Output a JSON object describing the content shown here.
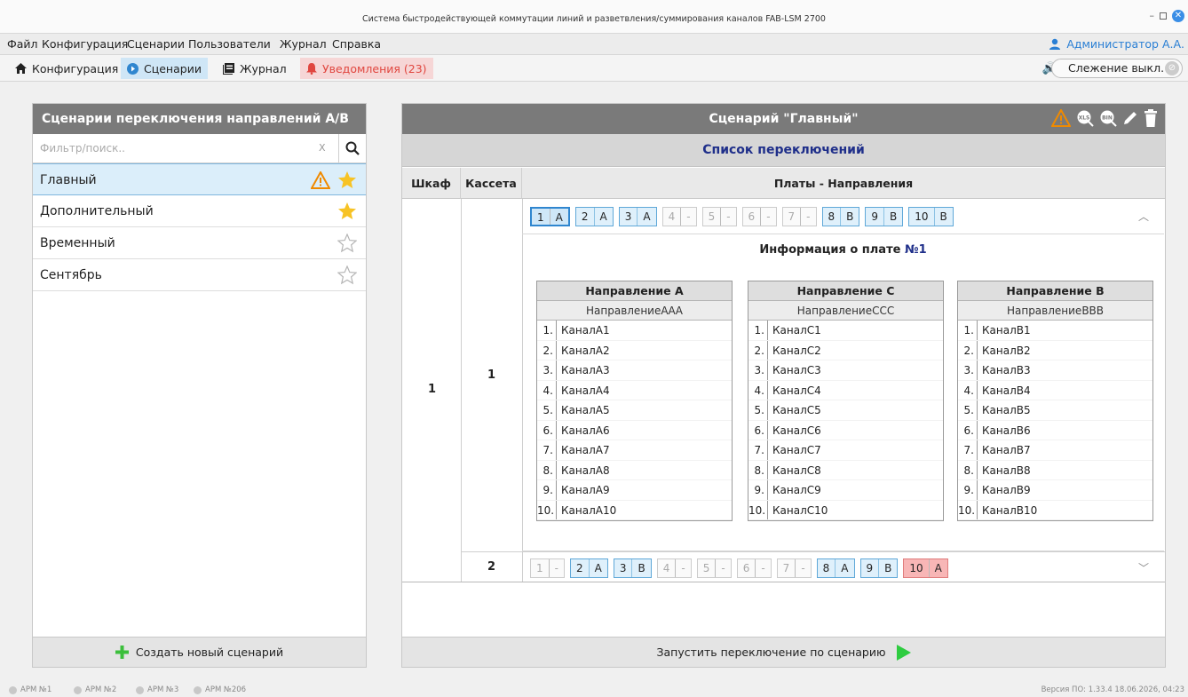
{
  "window": {
    "title": "Система быстродействующей коммутации линий и разветвления/суммирования каналов FAB-LSM 2700"
  },
  "menu": [
    "Файл",
    "Конфигурация",
    "Сценарии",
    "Пользователи",
    "Журнал",
    "Справка"
  ],
  "user": "Администратор А.А.",
  "toolbar": {
    "config": "Конфигурация",
    "scenarios": "Сценарии",
    "journal": "Журнал",
    "notifications": "Уведомления (23)",
    "tracking": "Слежение выкл."
  },
  "left": {
    "title": "Сценарии переключения направлений А/В",
    "filter_placeholder": "Фильтр/поиск..",
    "clear": "X",
    "items": [
      {
        "name": "Главный",
        "selected": true,
        "favorite": true,
        "warning": true
      },
      {
        "name": "Дополнительный",
        "favorite": true
      },
      {
        "name": "Временный",
        "favorite": false
      },
      {
        "name": "Сентябрь",
        "favorite": false
      }
    ],
    "create": "Создать новый сценарий"
  },
  "right": {
    "title": "Сценарий  \"Главный\"",
    "switch_list": "Список переключений",
    "cols": {
      "cabinet": "Шкаф",
      "cassette": "Кассета",
      "boards": "Платы - Направления"
    },
    "cabinet": "1",
    "cassettes": [
      {
        "num": "1",
        "plates": [
          [
            "1",
            "A"
          ],
          [
            "2",
            "A"
          ],
          [
            "3",
            "A"
          ],
          [
            "4",
            "-"
          ],
          [
            "5",
            "-"
          ],
          [
            "6",
            "-"
          ],
          [
            "7",
            "-"
          ],
          [
            "8",
            "B"
          ],
          [
            "9",
            "B"
          ],
          [
            "10",
            "B"
          ]
        ]
      },
      {
        "num": "2",
        "plates": [
          [
            "1",
            "-"
          ],
          [
            "2",
            "A"
          ],
          [
            "3",
            "B"
          ],
          [
            "4",
            "-"
          ],
          [
            "5",
            "-"
          ],
          [
            "6",
            "-"
          ],
          [
            "7",
            "-"
          ],
          [
            "8",
            "A"
          ],
          [
            "9",
            "B"
          ],
          [
            "10",
            "A"
          ]
        ]
      }
    ],
    "info_title": "Информация о плате",
    "info_num": "№1",
    "directions": [
      {
        "title": "Направление А",
        "sub": "НаправлениеААА",
        "prefix": "КаналА"
      },
      {
        "title": "Направление С",
        "sub": "НаправлениеССС",
        "prefix": "КаналС"
      },
      {
        "title": "Направление В",
        "sub": "НаправлениеВВВ",
        "prefix": "КаналВ"
      }
    ],
    "run": "Запустить переключение по сценарию"
  },
  "status": {
    "arms": [
      "АРМ №1",
      "АРМ №2",
      "АРМ №3",
      "АРМ №206"
    ],
    "version": "Версия ПО: 1.33.4    18.06.2026, 04:23"
  },
  "colors": {
    "accent": "#2f86cf",
    "warning": "#f08a00",
    "star": "#f7c325",
    "danger": "#e0463f",
    "header": "#7a7a7a",
    "go": "#2ecc40"
  }
}
